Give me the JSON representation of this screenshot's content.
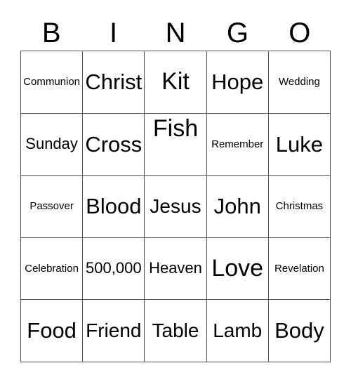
{
  "card": {
    "header_letters": [
      "B",
      "I",
      "N",
      "G",
      "O"
    ],
    "colors": {
      "background": "#ffffff",
      "text": "#000000",
      "border": "#555555"
    },
    "grid": {
      "columns": 5,
      "rows": 5
    },
    "cells": [
      [
        {
          "label": "Communion",
          "size": "t-xs",
          "align": "align-upper"
        },
        {
          "label": "Christ",
          "size": "t-lg",
          "align": "align-upper"
        },
        {
          "label": "Kit",
          "size": "t-xl",
          "align": "align-upper"
        },
        {
          "label": "Hope",
          "size": "t-lg",
          "align": "align-upper"
        },
        {
          "label": "Wedding",
          "size": "t-xs",
          "align": "align-upper"
        }
      ],
      [
        {
          "label": "Sunday",
          "size": "t-sm",
          "align": "align-upper"
        },
        {
          "label": "Cross",
          "size": "t-lg",
          "align": "align-upper"
        },
        {
          "label": "Fish",
          "size": "t-xl",
          "align": "align-top"
        },
        {
          "label": "Remember",
          "size": "t-xs",
          "align": "align-upper"
        },
        {
          "label": "Luke",
          "size": "t-lg",
          "align": "align-upper"
        }
      ],
      [
        {
          "label": "Passover",
          "size": "t-xs",
          "align": "align-upper"
        },
        {
          "label": "Blood",
          "size": "t-lg",
          "align": "align-upper"
        },
        {
          "label": "Jesus",
          "size": "t-md",
          "align": "align-upper"
        },
        {
          "label": "John",
          "size": "t-lg",
          "align": "align-upper"
        },
        {
          "label": "Christmas",
          "size": "t-xs",
          "align": "align-upper"
        }
      ],
      [
        {
          "label": "Celebration",
          "size": "t-xs",
          "align": "align-upper"
        },
        {
          "label": "500,000",
          "size": "t-sm",
          "align": "align-upper"
        },
        {
          "label": "Heaven",
          "size": "t-sm",
          "align": "align-upper"
        },
        {
          "label": "Love",
          "size": "t-xl",
          "align": "align-upper"
        },
        {
          "label": "Revelation",
          "size": "t-xs",
          "align": "align-upper"
        }
      ],
      [
        {
          "label": "Food",
          "size": "t-lg",
          "align": "align-upper"
        },
        {
          "label": "Friend",
          "size": "t-md",
          "align": "align-upper"
        },
        {
          "label": "Table",
          "size": "t-md",
          "align": "align-upper"
        },
        {
          "label": "Lamb",
          "size": "t-md",
          "align": "align-upper"
        },
        {
          "label": "Body",
          "size": "t-lg",
          "align": "align-upper"
        }
      ]
    ]
  }
}
